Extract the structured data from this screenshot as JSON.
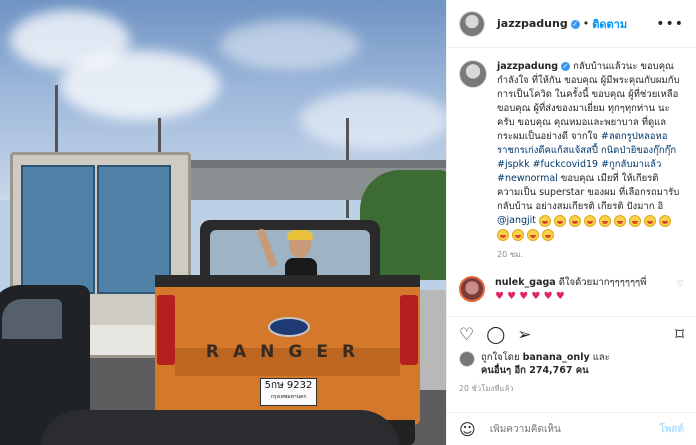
{
  "header": {
    "username": "jazzpadung",
    "separator": "•",
    "follow_label": "ติดตาม",
    "more_icon": "more-horizontal-icon"
  },
  "caption": {
    "username": "jazzpadung",
    "text": "กลับบ้านแล้วนะ ขอบคุณกำลังใจ ที่ให้กัน ขอบคุณ ผู้มีพระคุณกับผมกับการเป็นโควิด ในครั้งนี้ ขอบคุณ ผู้ที่ช่วยเหลือ ขอบคุณ ผู้ที่ส่งของมาเยี่ยม ทุกๆทุกท่าน นะครับ ขอบคุณ คุณหมอและพยาบาล ที่ดูแลกระผมเป็นอย่างดี จากใจ",
    "hashtags": "#ลดกรูปหลอหอราชกรเก่งดีคแก้สแจ้สสปี้ กนิดป่ายิของกุ๊กกุ๊ก #jspkk #fuckcovid19 #กูกลับมาแล้ว #newnormal",
    "text2": "ขอบคุณ เมียที่ ให้เกียรติ ความเป็น superstar ของผม ที่เลือกรถมารับกลับบ้าน อย่างสมเกียรติ เกียรติ ปังมาก อิ",
    "mention": "@jangjit",
    "time": "20 ชม."
  },
  "comment": {
    "username": "nulek_gaga",
    "text": "ดีใจด้วยมากๆๆๆๆๆๆพี่",
    "hearts": "♥ ♥ ♥ ♥ ♥ ♥",
    "like_icon": "heart-outline-icon"
  },
  "actions": {
    "like_icon": "heart-icon",
    "comment_icon": "comment-icon",
    "share_icon": "share-icon",
    "bookmark_icon": "bookmark-icon"
  },
  "likes": {
    "liked_by_prefix": "ถูกใจโดย",
    "liked_by_user": "banana_only",
    "and": "และ",
    "others": "คนอื่นๆ อีก 274,767 คน"
  },
  "post_time": "20 ชั่วโมงที่แล้ว",
  "add_comment": {
    "placeholder": "เพิ่มความคิดเห็น",
    "post_label": "โพสต์"
  },
  "photo": {
    "plate_text": "5กษ 9232",
    "plate_sub": "กรุงเทพมหานคร",
    "brand_text": "RANGER"
  }
}
